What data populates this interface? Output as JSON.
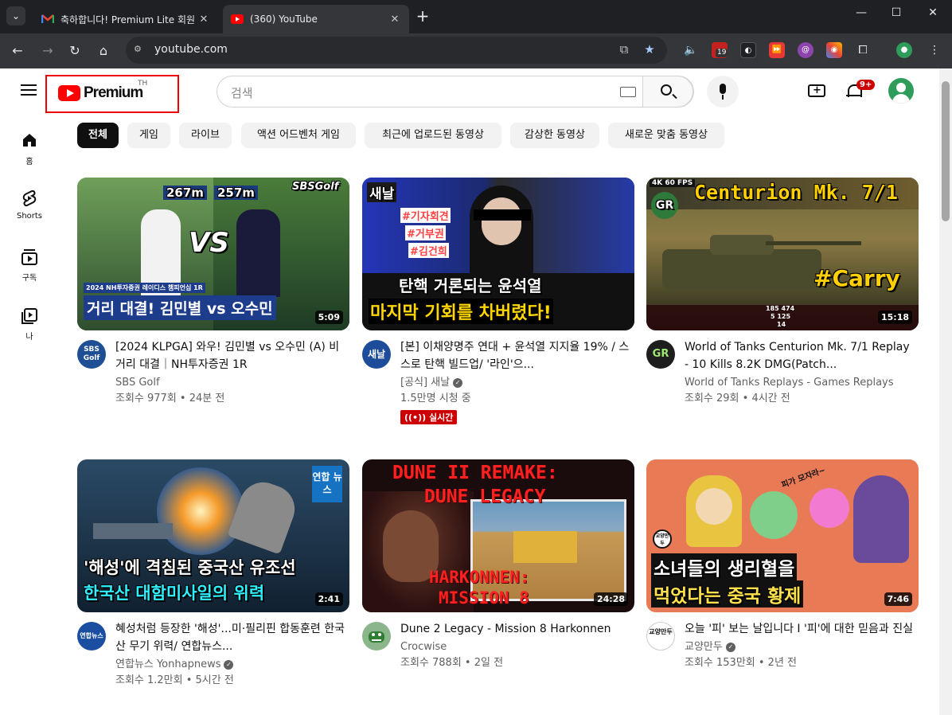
{
  "browser": {
    "tabs": [
      {
        "title": "축하합니다! Premium Lite 회원",
        "favicon": "gmail-icon"
      },
      {
        "title": "(360) YouTube",
        "favicon": "youtube-icon"
      }
    ],
    "url": "youtube.com",
    "ext_badge": "19"
  },
  "header": {
    "logo_text": "Premium",
    "country_code": "TH",
    "search_placeholder": "검색",
    "notif_count": "9+"
  },
  "guide": [
    {
      "label": "홈",
      "icon": "home-icon"
    },
    {
      "label": "Shorts",
      "icon": "shorts-icon"
    },
    {
      "label": "구독",
      "icon": "subscriptions-icon"
    },
    {
      "label": "나",
      "icon": "you-icon"
    }
  ],
  "chips": [
    "전체",
    "게임",
    "라이브",
    "액션 어드벤처 게임",
    "최근에 업로드된 동영상",
    "감상한 동영상",
    "새로운 맞춤 동영상"
  ],
  "videos": [
    {
      "title": "[2024 KLPGA] 와우! 김민별 vs 오수민 (A) 비거리 대결｜NH투자증권 1R",
      "channel": "SBS Golf",
      "verified": false,
      "stats": "조회수 977회 • 24분 전",
      "duration": "5:09",
      "avatar_text": "SBS Golf",
      "thumb_text": [
        "267m",
        "257m",
        "VS",
        "거리 대결! 김민별 vs 오수민",
        "SBSGolf",
        "2024 NH투자증권 레이디스 챔피언십 1R"
      ]
    },
    {
      "title": "[본] 이채양명주 연대 + 윤석열 지지율 19% / 스스로 탄핵 빌드업/ '라인'으...",
      "channel": "[공식] 새날",
      "verified": true,
      "stats": "1.5만명 시청 중",
      "live_badge": "실시간",
      "avatar_text": "새날",
      "thumb_text": [
        "새날",
        "#기자회견",
        "#거부권",
        "#김건희",
        "탄핵 거론되는 윤석열",
        "마지막 기회를 차버렸다!"
      ]
    },
    {
      "title": "World of Tanks Centurion Mk. 7/1 Replay - 10 Kills 8.2K DMG(Patch...",
      "channel": "World of Tanks Replays - Games Replays",
      "verified": false,
      "stats": "조회수 29회 • 4시간 전",
      "duration": "15:18",
      "avatar_text": "GR",
      "thumb_text": [
        "4K 60 FPS",
        "Centurion Mk. 7/1",
        "GR",
        "#Carry",
        "185 474",
        "5 125",
        "14"
      ]
    },
    {
      "title": "혜성처럼 등장한 '해성'...미·필리핀 합동훈련 한국산 무기 위력/ 연합뉴스...",
      "channel": "연합뉴스 Yonhapnews",
      "verified": true,
      "stats": "조회수 1.2만회 • 5시간 전",
      "duration": "2:41",
      "avatar_text": "연합뉴스",
      "thumb_text": [
        "연합 뉴스",
        "'해성'에 격침된 중국산 유조선",
        "한국산 대함미사일의 위력"
      ]
    },
    {
      "title": "Dune 2 Legacy - Mission 8 Harkonnen",
      "channel": "Crocwise",
      "verified": false,
      "stats": "조회수 788회 • 2일 전",
      "duration": "24:28",
      "avatar_text": "",
      "thumb_text": [
        "DUNE II REMAKE:",
        "DUNE LEGACY",
        "HARKONNEN:",
        "MISSION 8"
      ]
    },
    {
      "title": "오늘 '피' 보는 날입니다 I '피'에 대한 믿음과 진실",
      "channel": "교양만두",
      "verified": true,
      "stats": "조회수 153만회 • 2년 전",
      "duration": "7:46",
      "avatar_text": "교양만두",
      "thumb_text": [
        "피가 모자라~",
        "교양만두",
        "소녀들의 생리혈을",
        "먹었다는 중국 황제"
      ]
    }
  ],
  "colors": {
    "accent": "#ff0000",
    "live": "#cc0000",
    "chip_bg": "#f2f2f2",
    "chrome_dark": "#1f2023",
    "chrome_mid": "#35363a"
  }
}
